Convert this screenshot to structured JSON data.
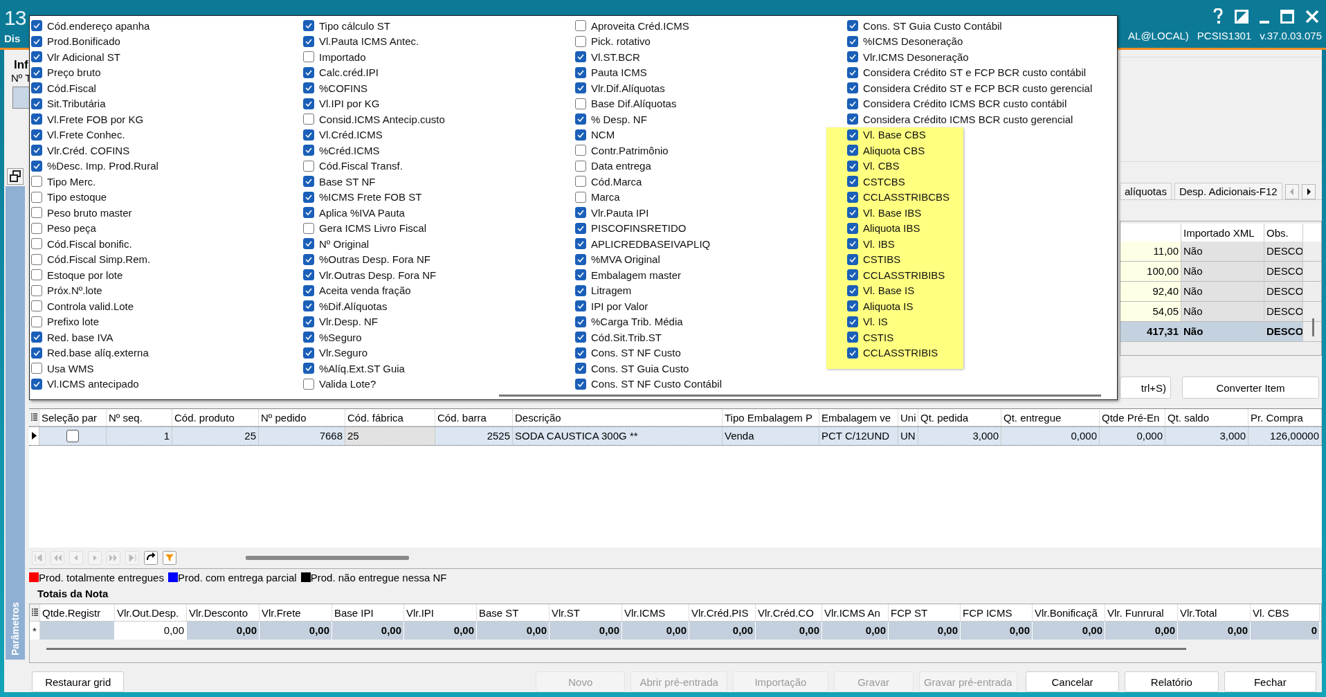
{
  "title_bar": {
    "title": "13",
    "subtitle": "Dis",
    "user": "AL@LOCAL)",
    "program": "PCSIS1301",
    "version": "v.37.0.03.075"
  },
  "left_panel": {
    "heading": "Inf",
    "label": "Nº T",
    "side_tab": "Parâmetros"
  },
  "column_chooser": {
    "columns": [
      {
        "items": [
          {
            "label": "Cód.endereço apanha",
            "checked": true
          },
          {
            "label": "Prod.Bonificado",
            "checked": true
          },
          {
            "label": "Vlr Adicional ST",
            "checked": true
          },
          {
            "label": "Preço bruto",
            "checked": true
          },
          {
            "label": "Cód.Fiscal",
            "checked": true
          },
          {
            "label": "Sit.Tributária",
            "checked": true
          },
          {
            "label": "Vl.Frete FOB por KG",
            "checked": true
          },
          {
            "label": "Vl.Frete Conhec.",
            "checked": true
          },
          {
            "label": "Vlr.Créd. COFINS",
            "checked": true
          },
          {
            "label": "%Desc. Imp. Prod.Rural",
            "checked": true
          },
          {
            "label": "Tipo Merc.",
            "checked": false
          },
          {
            "label": "Tipo estoque",
            "checked": false
          },
          {
            "label": "Peso bruto master",
            "checked": false
          },
          {
            "label": "Peso peça",
            "checked": false
          },
          {
            "label": "Cód.Fiscal bonific.",
            "checked": false
          },
          {
            "label": "Cód.Fiscal Simp.Rem.",
            "checked": false
          },
          {
            "label": "Estoque por lote",
            "checked": false
          },
          {
            "label": "Próx.Nº.lote",
            "checked": false
          },
          {
            "label": "Controla valid.Lote",
            "checked": false
          },
          {
            "label": "Prefixo lote",
            "checked": false
          },
          {
            "label": "Red. base IVA",
            "checked": true
          },
          {
            "label": "Red.base alíq.externa",
            "checked": true
          },
          {
            "label": "Usa WMS",
            "checked": false
          },
          {
            "label": "Vl.ICMS antecipado",
            "checked": true
          }
        ]
      },
      {
        "items": [
          {
            "label": "Tipo cálculo ST",
            "checked": true
          },
          {
            "label": "Vl.Pauta ICMS Antec.",
            "checked": true
          },
          {
            "label": "Importado",
            "checked": false
          },
          {
            "label": "Calc.créd.IPI",
            "checked": true
          },
          {
            "label": "%COFINS",
            "checked": true
          },
          {
            "label": "Vl.IPI por KG",
            "checked": true
          },
          {
            "label": "Consid.ICMS Antecip.custo",
            "checked": false
          },
          {
            "label": "Vl.Créd.ICMS",
            "checked": true
          },
          {
            "label": "%Créd.ICMS",
            "checked": true
          },
          {
            "label": "Cód.Fiscal Transf.",
            "checked": false
          },
          {
            "label": "Base ST NF",
            "checked": true
          },
          {
            "label": "%ICMS Frete FOB ST",
            "checked": true
          },
          {
            "label": "Aplica %IVA Pauta",
            "checked": true
          },
          {
            "label": "Gera ICMS Livro Fiscal",
            "checked": false
          },
          {
            "label": "Nº Original",
            "checked": true
          },
          {
            "label": "%Outras Desp. Fora NF",
            "checked": true
          },
          {
            "label": "Vlr.Outras Desp. Fora NF",
            "checked": true
          },
          {
            "label": "Aceita venda fração",
            "checked": true
          },
          {
            "label": "%Dif.Alíquotas",
            "checked": true
          },
          {
            "label": "Vlr.Desp. NF",
            "checked": true
          },
          {
            "label": "%Seguro",
            "checked": true
          },
          {
            "label": "Vlr.Seguro",
            "checked": true
          },
          {
            "label": "%Alíq.Ext.ST Guia",
            "checked": true
          },
          {
            "label": "Valida Lote?",
            "checked": false
          }
        ]
      },
      {
        "items": [
          {
            "label": "Aproveita Créd.ICMS",
            "checked": false
          },
          {
            "label": "Pick. rotativo",
            "checked": false
          },
          {
            "label": "Vl.ST.BCR",
            "checked": true
          },
          {
            "label": "Pauta ICMS",
            "checked": true
          },
          {
            "label": "Vlr.Dif.Alíquotas",
            "checked": true
          },
          {
            "label": "Base Dif.Alíquotas",
            "checked": false
          },
          {
            "label": "% Desp. NF",
            "checked": true
          },
          {
            "label": "NCM",
            "checked": true
          },
          {
            "label": "Contr.Patrimônio",
            "checked": false
          },
          {
            "label": "Data entrega",
            "checked": false
          },
          {
            "label": "Cód.Marca",
            "checked": false
          },
          {
            "label": "Marca",
            "checked": false
          },
          {
            "label": "Vlr.Pauta IPI",
            "checked": true
          },
          {
            "label": "PISCOFINSRETIDO",
            "checked": true
          },
          {
            "label": "APLICREDBASEIVAPLIQ",
            "checked": true
          },
          {
            "label": "%MVA Original",
            "checked": true
          },
          {
            "label": "Embalagem master",
            "checked": true
          },
          {
            "label": "Litragem",
            "checked": true
          },
          {
            "label": "IPI por Valor",
            "checked": true
          },
          {
            "label": "%Carga Trib. Média",
            "checked": true
          },
          {
            "label": "Cód.Sit.Trib.ST",
            "checked": true
          },
          {
            "label": "Cons. ST NF Custo",
            "checked": true
          },
          {
            "label": "Cons. ST Guia Custo",
            "checked": true
          },
          {
            "label": "Cons. ST NF Custo Contábil",
            "checked": true
          }
        ]
      },
      {
        "items": [
          {
            "label": "Cons. ST Guia Custo Contábil",
            "checked": true
          },
          {
            "label": "%ICMS Desoneração",
            "checked": true
          },
          {
            "label": "Vlr.ICMS Desoneração",
            "checked": true
          },
          {
            "label": "Considera Crédito ST e FCP BCR custo contábil",
            "checked": true
          },
          {
            "label": "Considera Crédito ST e FCP BCR custo gerencial",
            "checked": true
          },
          {
            "label": "Considera Crédito ICMS BCR custo contábil",
            "checked": true
          },
          {
            "label": "Considera Crédito ICMS BCR custo gerencial",
            "checked": true
          }
        ],
        "highlighted_items": [
          {
            "label": "Vl. Base CBS",
            "checked": true
          },
          {
            "label": "Aliquota CBS",
            "checked": true
          },
          {
            "label": "Vl. CBS",
            "checked": true
          },
          {
            "label": "CSTCBS",
            "checked": true
          },
          {
            "label": "CCLASSTRIBCBS",
            "checked": true
          },
          {
            "label": "Vl. Base IBS",
            "checked": true
          },
          {
            "label": "Aliquota IBS",
            "checked": true
          },
          {
            "label": "Vl. IBS",
            "checked": true
          },
          {
            "label": "CSTIBS",
            "checked": true
          },
          {
            "label": "CCLASSTRIBIBS",
            "checked": true
          },
          {
            "label": "Vl. Base IS",
            "checked": true
          },
          {
            "label": "Aliquota IS",
            "checked": true
          },
          {
            "label": "Vl. IS",
            "checked": true
          },
          {
            "label": "CSTIS",
            "checked": true
          },
          {
            "label": "CCLASSTRIBIS",
            "checked": true
          }
        ]
      }
    ]
  },
  "detail_panel": {
    "tabs": [
      {
        "label": "alíquotas",
        "selected": false
      },
      {
        "label": "Desp. Adicionais-F12",
        "selected": false
      }
    ],
    "table": {
      "columns": [
        "",
        "Importado XML",
        "Obs."
      ],
      "rows": [
        {
          "cells": [
            "11,00",
            "Não",
            "DESCO"
          ],
          "total": false
        },
        {
          "cells": [
            "100,00",
            "Não",
            "DESCO"
          ],
          "total": false
        },
        {
          "cells": [
            "92,40",
            "Não",
            "DESCO"
          ],
          "total": false
        },
        {
          "cells": [
            "54,05",
            "Não",
            "DESCO"
          ],
          "total": false
        },
        {
          "cells": [
            "417,31",
            "Não",
            "DESCO"
          ],
          "total": true
        }
      ]
    },
    "buttons": [
      "trl+S)",
      "Converter Item"
    ]
  },
  "items_table": {
    "columns": [
      "Seleção par",
      "Nº seq.",
      "Cód. produto",
      "Nº pedido",
      "Cód. fábrica",
      "Cód. barra",
      "Descrição",
      "Tipo Embalagem P",
      "Embalagem ve",
      "Uni",
      "Qt. pedida",
      "Qt. entregue",
      "Qtde Pré-En",
      "Qt. saldo",
      "Pr. Compra"
    ],
    "rows": [
      {
        "current": true,
        "checked": false,
        "cells": [
          "",
          "1",
          "25",
          "7668",
          "25",
          "2525",
          "SODA CAUSTICA 300G **",
          "Venda",
          "PCT C/12UND",
          "UN",
          "3,000",
          "0,000",
          "0,000",
          "3,000",
          "126,00000"
        ]
      }
    ]
  },
  "legend": [
    {
      "label": "Prod. totalmente entregues",
      "color": "#ff0000"
    },
    {
      "label": "Prod. com entrega parcial",
      "color": "#0000ff"
    },
    {
      "label": "Prod. não entregue nessa NF",
      "color": "#000000"
    }
  ],
  "totals": {
    "title": "Totais da Nota",
    "new_row_marker": "*",
    "columns": [
      "Qtde.Registr",
      "Vlr.Out.Desp.",
      "Vlr.Desconto",
      "Vlr.Frete",
      "Base IPI",
      "Vlr.IPI",
      "Base ST",
      "Vlr.ST",
      "Vlr.ICMS",
      "Vlr.Créd.PIS",
      "Vlr.Créd.CO",
      "Vlr.ICMS An",
      "FCP ST",
      "FCP ICMS",
      "Vlr.Bonificaçã",
      "Vlr. Funrural",
      "Vlr.Total",
      "Vl. CBS"
    ],
    "cells": [
      {
        "kind": "blank"
      },
      {
        "kind": "editable",
        "text": "0,00"
      },
      {
        "kind": "total",
        "text": "0,00"
      },
      {
        "kind": "total",
        "text": "0,00"
      },
      {
        "kind": "total",
        "text": "0,00"
      },
      {
        "kind": "total",
        "text": "0,00"
      },
      {
        "kind": "total",
        "text": "0,00"
      },
      {
        "kind": "total",
        "text": "0,00"
      },
      {
        "kind": "total",
        "text": "0,00"
      },
      {
        "kind": "total",
        "text": "0,00"
      },
      {
        "kind": "total",
        "text": "0,00"
      },
      {
        "kind": "total",
        "text": "0,00"
      },
      {
        "kind": "total",
        "text": "0,00"
      },
      {
        "kind": "total",
        "text": "0,00"
      },
      {
        "kind": "total",
        "text": "0,00"
      },
      {
        "kind": "total",
        "text": "0,00"
      },
      {
        "kind": "total",
        "text": "0,00"
      },
      {
        "kind": "total",
        "text": "0"
      }
    ]
  },
  "buttons": [
    {
      "label": "Restaurar grid",
      "disabled": false
    },
    {
      "label": "Novo",
      "disabled": true
    },
    {
      "label": "Abrir pré-entrada",
      "disabled": true
    },
    {
      "label": "Importação",
      "disabled": true
    },
    {
      "label": "Gravar",
      "disabled": true
    },
    {
      "label": "Gravar pré-entrada",
      "disabled": true
    },
    {
      "label": "Cancelar",
      "disabled": false
    },
    {
      "label": "Relatório",
      "disabled": false
    },
    {
      "label": "Fechar",
      "disabled": false
    }
  ]
}
